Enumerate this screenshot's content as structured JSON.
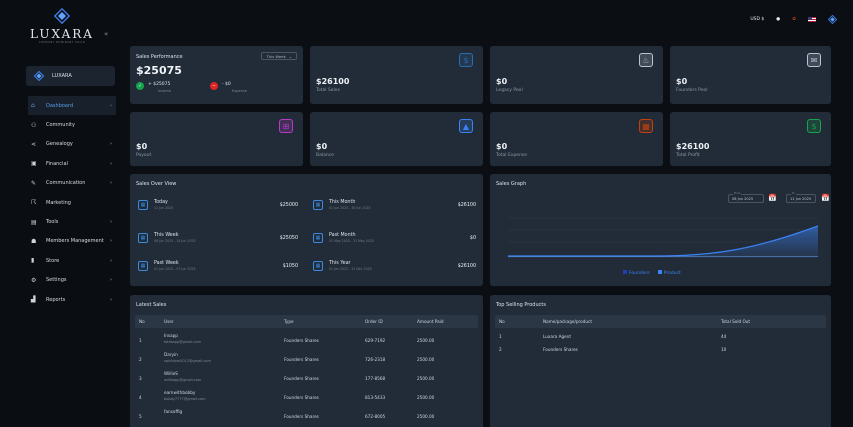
{
  "brand": {
    "name": "LUXARA",
    "tagline": "COMPANY DOMINANT SOLID",
    "card_name": "LUXARA"
  },
  "nav": [
    {
      "label": "Dashboard",
      "icon": "home-icon",
      "glyph": "⌂",
      "chev": "›",
      "active": true
    },
    {
      "label": "Community",
      "icon": "community-icon",
      "glyph": "⚇",
      "chev": ""
    },
    {
      "label": "Genealogy",
      "icon": "genealogy-icon",
      "glyph": "⋖",
      "chev": "›"
    },
    {
      "label": "Financial",
      "icon": "financial-icon",
      "glyph": "▣",
      "chev": "›"
    },
    {
      "label": "Communication",
      "icon": "chat-icon",
      "glyph": "✎",
      "chev": "›"
    },
    {
      "label": "Marketing",
      "icon": "marketing-icon",
      "glyph": "☈",
      "chev": ""
    },
    {
      "label": "Tools",
      "icon": "tools-icon",
      "glyph": "▤",
      "chev": "›"
    },
    {
      "label": "Members Management",
      "icon": "members-icon",
      "glyph": "☗",
      "chev": "›"
    },
    {
      "label": "Store",
      "icon": "store-icon",
      "glyph": "▮",
      "chev": "›"
    },
    {
      "label": "Settings",
      "icon": "settings-icon",
      "glyph": "⚙",
      "chev": "›"
    },
    {
      "label": "Reports",
      "icon": "reports-icon",
      "glyph": "▟",
      "chev": "›"
    }
  ],
  "topbar": {
    "currency": "USD $"
  },
  "sales_performance": {
    "title": "Sales Performance",
    "period": "This Week",
    "total": "$25075",
    "income_value": "+ $25075",
    "income_label": "Income",
    "expense_value": "- $0",
    "expense_label": "Expense"
  },
  "stats": [
    {
      "value": "$26100",
      "label": "Total Sales",
      "icon": "dollar-icon",
      "color": "#2b6cb0"
    },
    {
      "value": "$0",
      "label": "Legacy Pool",
      "icon": "pool-icon",
      "color": "#b7c5d6"
    },
    {
      "value": "$0",
      "label": "Founders Pool",
      "icon": "founders-icon",
      "color": "#b7c5d6"
    },
    {
      "value": "$0",
      "label": "Payout",
      "icon": "gift-icon",
      "color": "#b93ac8"
    },
    {
      "value": "$0",
      "label": "Balance",
      "icon": "balance-icon",
      "color": "#3b82f6"
    },
    {
      "value": "$0",
      "label": "Total Expense",
      "icon": "expense-icon",
      "color": "#c2410c"
    },
    {
      "value": "$26100",
      "label": "Total Profit",
      "icon": "profit-icon",
      "color": "#16a34a"
    }
  ],
  "sales_overview": {
    "title": "Sales Over View",
    "items": [
      {
        "name": "Today",
        "date": "11 Jun 2025",
        "amount": "$25000"
      },
      {
        "name": "This Month",
        "date": "01 Jun 2025 - 30 Jun 2025",
        "amount": "$26100"
      },
      {
        "name": "This Week",
        "date": "08 Jun 2025 - 14 Jun 2025",
        "amount": "$25050"
      },
      {
        "name": "Past Month",
        "date": "01 May 2025 - 31 May 2025",
        "amount": "$0"
      },
      {
        "name": "Past Week",
        "date": "01 Jun 2025 - 07 Jun 2025",
        "amount": "$1050"
      },
      {
        "name": "This Year",
        "date": "01 Jan 2025 - 31 Dec 2025",
        "amount": "$26100"
      }
    ]
  },
  "sales_graph": {
    "title": "Sales Graph",
    "from_caption": "From",
    "from_date": "08 Jun 2025",
    "to_caption": "To",
    "to_date": "11 Jun 2025",
    "legend": [
      "Founders",
      "Product"
    ]
  },
  "latest_sales": {
    "title": "Latest Sales",
    "columns": [
      "No",
      "User",
      "Type",
      "Order ID",
      "Amount Paid"
    ],
    "rows": [
      {
        "no": "1",
        "user": "Insapp",
        "email": "fotiisapp@gmail.com",
        "type": "Founders Shares",
        "order": "629-7192",
        "amount": "2500.00"
      },
      {
        "no": "2",
        "user": "Daryin",
        "email": "spiritlove2012@gmail.com",
        "type": "Founders Shares",
        "order": "726-2318",
        "amount": "2500.00"
      },
      {
        "no": "3",
        "user": "WillieS",
        "email": "willieapp@gmail.com",
        "type": "Founders Shares",
        "order": "177-8568",
        "amount": "2500.00"
      },
      {
        "no": "4",
        "user": "earnwithbobby",
        "email": "bobby7777@gmail.com",
        "type": "Founders Shares",
        "order": "813-5433",
        "amount": "2500.00"
      },
      {
        "no": "5",
        "user": "fansoffig",
        "email": "",
        "type": "Founders Shares",
        "order": "672-8005",
        "amount": "2500.00"
      }
    ]
  },
  "top_products": {
    "title": "Top Selling Products",
    "columns": [
      "No",
      "Name/package/product",
      "Total Sold Out"
    ],
    "rows": [
      {
        "no": "1",
        "name": "Luxara Agent",
        "sold": "44"
      },
      {
        "no": "2",
        "name": "Founders Shares",
        "sold": "10"
      }
    ]
  }
}
